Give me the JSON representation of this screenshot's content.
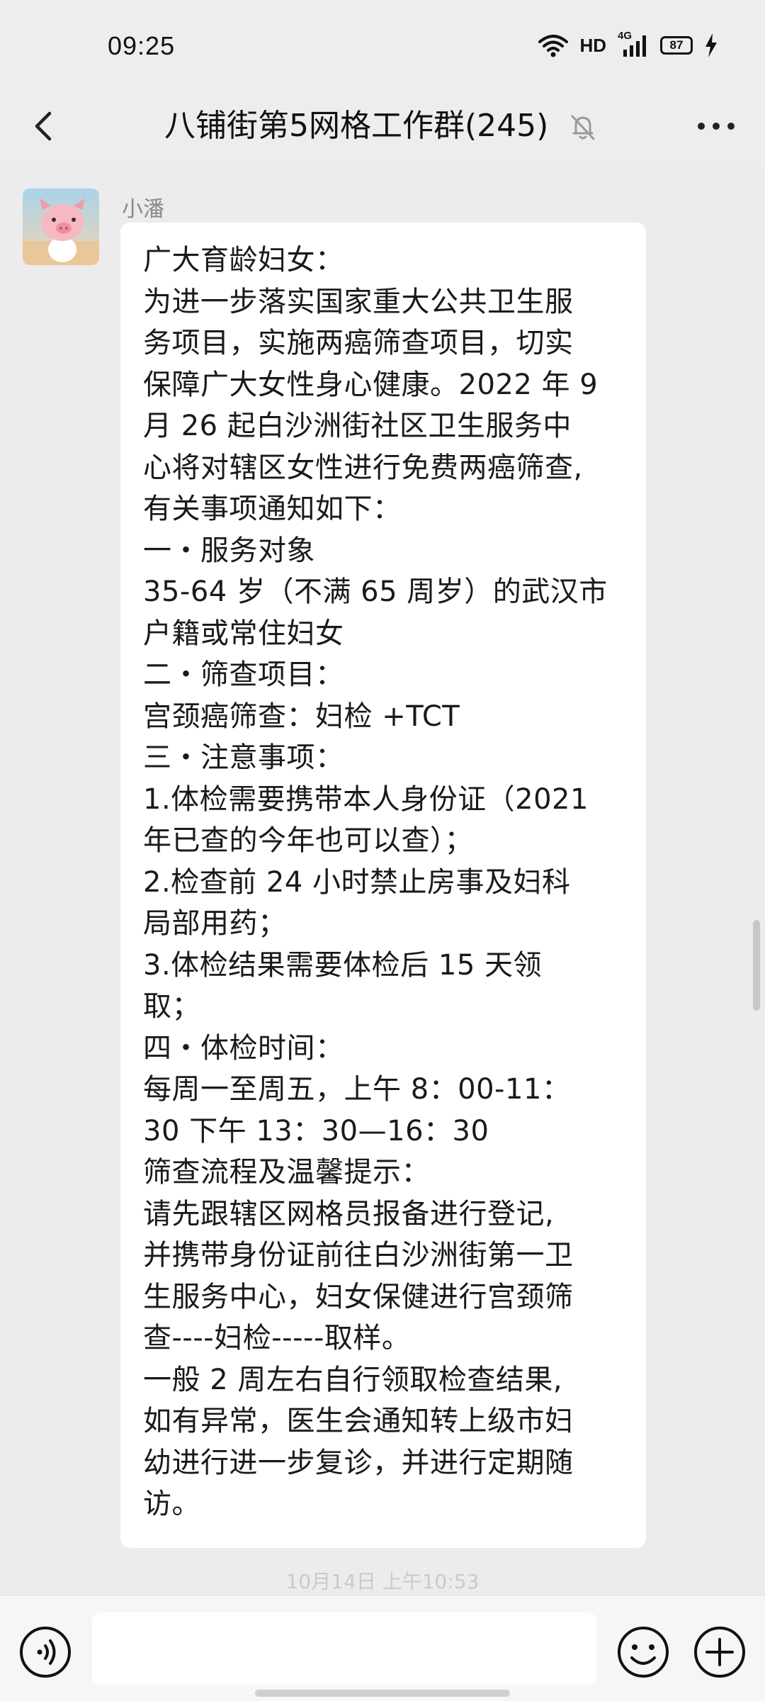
{
  "status_bar": {
    "time": "09:25",
    "network": "HD",
    "signal": "4G",
    "battery": "87"
  },
  "header": {
    "title": "八铺街第5网格工作群(245)",
    "back_icon": "chevron-left-icon",
    "mute_icon": "bell-muted-icon",
    "more_icon": "more-dots-icon"
  },
  "message": {
    "sender": "小潘",
    "lines": [
      "广大育龄妇女：",
      "为进一步落实国家重大公共卫生服",
      "务项目，实施两癌筛查项目，切实",
      "保障广大女性身心健康。2022 年 9",
      "月 26 起白沙洲街社区卫生服务中",
      "心将对辖区女性进行免费两癌筛查,",
      "有关事项通知如下：",
      "一・服务对象",
      "35-64 岁（不满 65 周岁）的武汉市",
      "户籍或常住妇女",
      "二・筛查项目：",
      "宫颈癌筛查：妇检 +TCT",
      "三・注意事项：",
      "1.体检需要携带本人身份证（2021",
      "年已查的今年也可以查）；",
      "2.检查前 24 小时禁止房事及妇科",
      "局部用药；",
      "3.体检结果需要体检后 15 天领",
      "取；",
      "四・体检时间：",
      "每周一至周五，上午 8：00-11：",
      "30 下午 13：30—16：30",
      "筛查流程及温馨提示：",
      "请先跟辖区网格员报备进行登记,",
      "并携带身份证前往白沙洲街第一卫",
      "生服务中心，妇女保健进行宫颈筛",
      "查----妇检-----取样。",
      "一般 2 周左右自行领取检查结果,",
      "如有异常，医生会通知转上级市妇",
      "幼进行进一步复诊，并进行定期随",
      "访。"
    ]
  },
  "timestamp": "10月14日 上午10:53",
  "input_bar": {
    "voice_icon": "voice-icon",
    "emoji_icon": "emoji-icon",
    "plus_icon": "plus-circle-icon",
    "input_value": ""
  },
  "colors": {
    "background": "#ececec",
    "bubble": "#ffffff",
    "text": "#1a1a1a",
    "sender_name": "#888888"
  }
}
